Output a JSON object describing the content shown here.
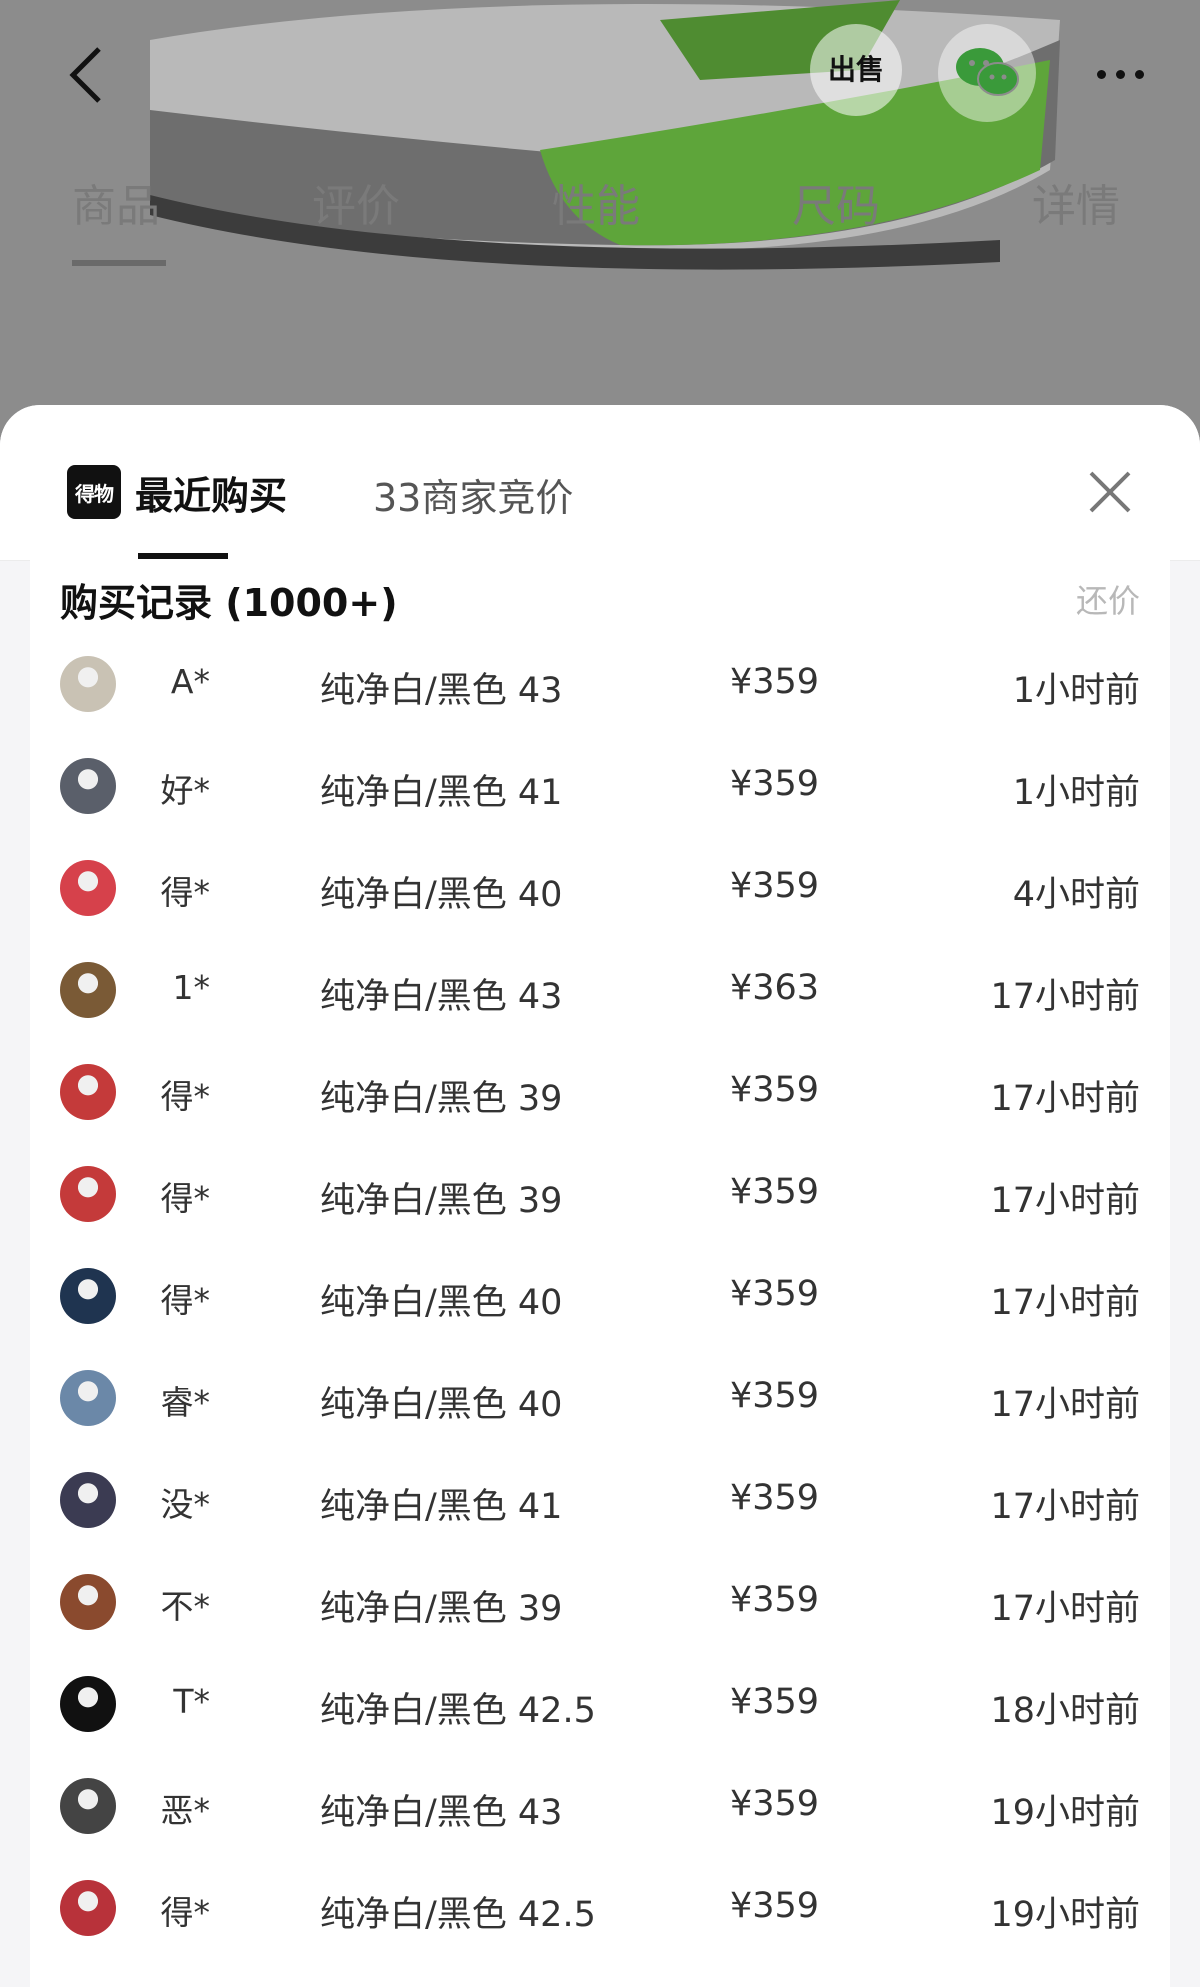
{
  "background_page": {
    "sell_label": "出售",
    "tabs": [
      "商品",
      "评价",
      "性能",
      "尺码",
      "详情"
    ]
  },
  "sheet": {
    "logo_text": "得物",
    "tab_recent": "最近购买",
    "tab_bidding": "33商家竞价",
    "card_title": "购买记录 (1000+)",
    "bargain_label": "还价",
    "records": [
      {
        "user": "A*",
        "spec": "纯净白/黑色 43",
        "price": "¥359",
        "time": "1小时前",
        "avatar_color": "#c9c2b4"
      },
      {
        "user": "好*",
        "spec": "纯净白/黑色 41",
        "price": "¥359",
        "time": "1小时前",
        "avatar_color": "#5a5f6a"
      },
      {
        "user": "得*",
        "spec": "纯净白/黑色 40",
        "price": "¥359",
        "time": "4小时前",
        "avatar_color": "#d6414b"
      },
      {
        "user": "1*",
        "spec": "纯净白/黑色 43",
        "price": "¥363",
        "time": "17小时前",
        "avatar_color": "#7a5a36"
      },
      {
        "user": "得*",
        "spec": "纯净白/黑色 39",
        "price": "¥359",
        "time": "17小时前",
        "avatar_color": "#c43a3a"
      },
      {
        "user": "得*",
        "spec": "纯净白/黑色 39",
        "price": "¥359",
        "time": "17小时前",
        "avatar_color": "#c43a3a"
      },
      {
        "user": "得*",
        "spec": "纯净白/黑色 40",
        "price": "¥359",
        "time": "17小时前",
        "avatar_color": "#1f3450"
      },
      {
        "user": "睿*",
        "spec": "纯净白/黑色 40",
        "price": "¥359",
        "time": "17小时前",
        "avatar_color": "#6b88a8"
      },
      {
        "user": "没*",
        "spec": "纯净白/黑色 41",
        "price": "¥359",
        "time": "17小时前",
        "avatar_color": "#3b3b52"
      },
      {
        "user": "不*",
        "spec": "纯净白/黑色 39",
        "price": "¥359",
        "time": "17小时前",
        "avatar_color": "#8a4a2e"
      },
      {
        "user": "T*",
        "spec": "纯净白/黑色 42.5",
        "price": "¥359",
        "time": "18小时前",
        "avatar_color": "#111111"
      },
      {
        "user": "恶*",
        "spec": "纯净白/黑色 43",
        "price": "¥359",
        "time": "19小时前",
        "avatar_color": "#444444"
      },
      {
        "user": "得*",
        "spec": "纯净白/黑色 42.5",
        "price": "¥359",
        "time": "19小时前",
        "avatar_color": "#b8323a"
      }
    ]
  },
  "colors": {
    "accent_green": "#6fdc3c",
    "text_primary": "#333333",
    "overlay_gray": "#8c8c8c"
  }
}
